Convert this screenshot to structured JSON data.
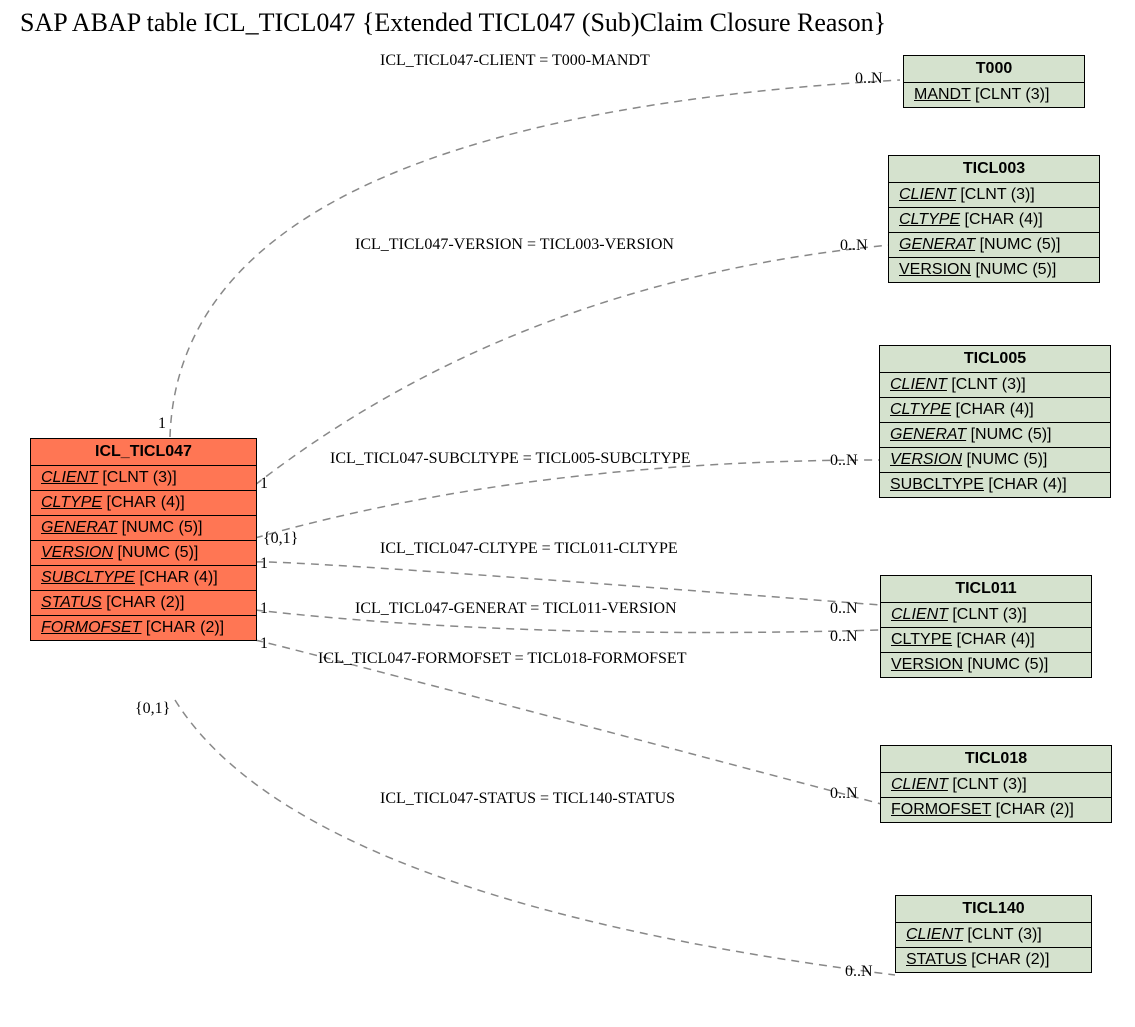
{
  "title": "SAP ABAP table ICL_TICL047 {Extended TICL047 (Sub)Claim Closure Reason}",
  "main": {
    "name": "ICL_TICL047",
    "fields": [
      {
        "name": "CLIENT",
        "type": "[CLNT (3)]"
      },
      {
        "name": "CLTYPE",
        "type": "[CHAR (4)]"
      },
      {
        "name": "GENERAT",
        "type": "[NUMC (5)]"
      },
      {
        "name": "VERSION",
        "type": "[NUMC (5)]"
      },
      {
        "name": "SUBCLTYPE",
        "type": "[CHAR (4)]"
      },
      {
        "name": "STATUS",
        "type": "[CHAR (2)]"
      },
      {
        "name": "FORMOFSET",
        "type": "[CHAR (2)]"
      }
    ]
  },
  "refs": {
    "t000": {
      "name": "T000",
      "fields": [
        {
          "name": "MANDT",
          "type": "[CLNT (3)]"
        }
      ]
    },
    "ticl003": {
      "name": "TICL003",
      "fields": [
        {
          "name": "CLIENT",
          "type": "[CLNT (3)]",
          "italic": true
        },
        {
          "name": "CLTYPE",
          "type": "[CHAR (4)]",
          "italic": true
        },
        {
          "name": "GENERAT",
          "type": "[NUMC (5)]",
          "italic": true
        },
        {
          "name": "VERSION",
          "type": "[NUMC (5)]"
        }
      ]
    },
    "ticl005": {
      "name": "TICL005",
      "fields": [
        {
          "name": "CLIENT",
          "type": "[CLNT (3)]",
          "italic": true
        },
        {
          "name": "CLTYPE",
          "type": "[CHAR (4)]",
          "italic": true
        },
        {
          "name": "GENERAT",
          "type": "[NUMC (5)]",
          "italic": true
        },
        {
          "name": "VERSION",
          "type": "[NUMC (5)]",
          "italic": true
        },
        {
          "name": "SUBCLTYPE",
          "type": "[CHAR (4)]"
        }
      ]
    },
    "ticl011": {
      "name": "TICL011",
      "fields": [
        {
          "name": "CLIENT",
          "type": "[CLNT (3)]",
          "italic": true
        },
        {
          "name": "CLTYPE",
          "type": "[CHAR (4)]"
        },
        {
          "name": "VERSION",
          "type": "[NUMC (5)]"
        }
      ]
    },
    "ticl018": {
      "name": "TICL018",
      "fields": [
        {
          "name": "CLIENT",
          "type": "[CLNT (3)]",
          "italic": true
        },
        {
          "name": "FORMOFSET",
          "type": "[CHAR (2)]"
        }
      ]
    },
    "ticl140": {
      "name": "TICL140",
      "fields": [
        {
          "name": "CLIENT",
          "type": "[CLNT (3)]",
          "italic": true
        },
        {
          "name": "STATUS",
          "type": "[CHAR (2)]"
        }
      ]
    }
  },
  "edges": {
    "e1": "ICL_TICL047-CLIENT = T000-MANDT",
    "e2": "ICL_TICL047-VERSION = TICL003-VERSION",
    "e3": "ICL_TICL047-SUBCLTYPE = TICL005-SUBCLTYPE",
    "e4": "ICL_TICL047-CLTYPE = TICL011-CLTYPE",
    "e5": "ICL_TICL047-GENERAT = TICL011-VERSION",
    "e6": "ICL_TICL047-FORMOFSET = TICL018-FORMOFSET",
    "e7": "ICL_TICL047-STATUS = TICL140-STATUS"
  },
  "cards": {
    "c1a": "1",
    "c1b": "0..N",
    "c2a": "1",
    "c2b": "0..N",
    "c3a": "{0,1}",
    "c3b": "0..N",
    "c4a": "1",
    "c5a": "1",
    "c5b": "0..N",
    "c6a": "1",
    "c6b": "0..N",
    "c7a": "{0,1}",
    "c7b": "0..N"
  }
}
